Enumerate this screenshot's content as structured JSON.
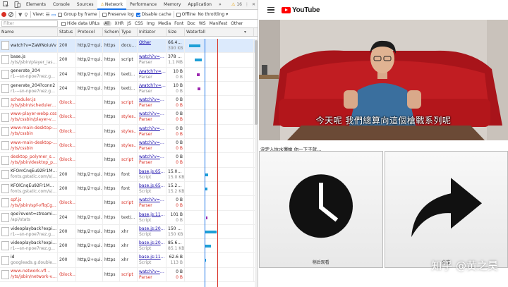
{
  "devtools": {
    "tabs": [
      "Elements",
      "Console",
      "Sources",
      "Network",
      "Performance",
      "Memory",
      "Application"
    ],
    "active_tab": "Network",
    "warning_count": "16",
    "toolbar": {
      "view_label": "View:",
      "group_by_frame": "Group by frame",
      "preserve_log": "Preserve log",
      "disable_cache": "Disable cache",
      "offline": "Offline",
      "throttling": "No throttling"
    },
    "filter": {
      "placeholder": "Filter",
      "hide_data_urls": "Hide data URLs",
      "types": [
        "All",
        "XHR",
        "JS",
        "CSS",
        "Img",
        "Media",
        "Font",
        "Doc",
        "WS",
        "Manifest",
        "Other"
      ]
    },
    "columns": [
      "Name",
      "Status",
      "Protocol",
      "Scheme",
      "Type",
      "Initiator",
      "Size",
      "Waterfall"
    ],
    "rows": [
      {
        "n1": "watch?v=ZaWNoiuVv",
        "n2": "",
        "status": "200",
        "proto": "http/2+qui...",
        "scheme": "https",
        "type": "docu...",
        "init1": "Other",
        "init2": "",
        "size1": "66.4 KB",
        "size2": "390 KB",
        "blocked": false,
        "selected": true,
        "bar_start": 0.0,
        "bar_len": 0.16,
        "bar_color": "#1e9fd6"
      },
      {
        "n1": "base.js",
        "n2": "/yts/jsbin/player_ias...",
        "status": "200",
        "proto": "http/2+qui...",
        "scheme": "https",
        "type": "script",
        "init1": "watch?v=Z...",
        "init2": "Parser",
        "size1": "378 KB",
        "size2": "1.1 MB",
        "blocked": false,
        "selected": false,
        "bar_start": 0.08,
        "bar_len": 0.1,
        "bar_color": "#1e9fd6"
      },
      {
        "n1": "generate_204",
        "n2": "r1---sn-npoe7nez.goo...",
        "status": "204",
        "proto": "http/2+qui...",
        "scheme": "https",
        "type": "text/...",
        "init1": "/watch?v=Z...",
        "init2": "Parser",
        "size1": "10 B",
        "size2": "0 B",
        "blocked": false,
        "selected": false,
        "bar_start": 0.11,
        "bar_len": 0.04,
        "bar_color": "#9c27b0"
      },
      {
        "n1": "generate_204?conn2",
        "n2": "r1---sn-npoe7nez.goo...",
        "status": "204",
        "proto": "http/2+qui...",
        "scheme": "https",
        "type": "text/...",
        "init1": "/watch?v=Z...",
        "init2": "Parser",
        "size1": "10 B",
        "size2": "0 B",
        "blocked": false,
        "selected": false,
        "bar_start": 0.12,
        "bar_len": 0.04,
        "bar_color": "#9c27b0"
      },
      {
        "n1": "scheduler.js",
        "n2": "/yts/jsbin/scheduler-...",
        "status": "(block...",
        "proto": "",
        "scheme": "https",
        "type": "script",
        "init1": "watch?v=Z...",
        "init2": "Parser",
        "size1": "0 B",
        "size2": "0 B",
        "blocked": true,
        "selected": false,
        "bar_start": 0,
        "bar_len": 0,
        "bar_color": ""
      },
      {
        "n1": "www-player-webp.css",
        "n2": "/yts/cssbin/player-vfl...",
        "status": "(block...",
        "proto": "",
        "scheme": "https",
        "type": "styles...",
        "init1": "watch?v=Z...",
        "init2": "Parser",
        "size1": "0 B",
        "size2": "0 B",
        "blocked": true,
        "selected": false,
        "bar_start": 0,
        "bar_len": 0,
        "bar_color": ""
      },
      {
        "n1": "www-main-desktop-...",
        "n2": "/yts/cssbin",
        "status": "(block...",
        "proto": "",
        "scheme": "https",
        "type": "styles...",
        "init1": "watch?v=Z...",
        "init2": "Parser",
        "size1": "0 B",
        "size2": "0 B",
        "blocked": true,
        "selected": false,
        "bar_start": 0,
        "bar_len": 0,
        "bar_color": ""
      },
      {
        "n1": "www-main-desktop-...",
        "n2": "/yts/cssbin",
        "status": "(block...",
        "proto": "",
        "scheme": "https",
        "type": "styles...",
        "init1": "watch?v=Z...",
        "init2": "Parser",
        "size1": "0 B",
        "size2": "0 B",
        "blocked": true,
        "selected": false,
        "bar_start": 0,
        "bar_len": 0,
        "bar_color": ""
      },
      {
        "n1": "desktop_polymer_sel...",
        "n2": "/yts/jsbin/desktop_po...",
        "status": "(block...",
        "proto": "",
        "scheme": "https",
        "type": "script",
        "init1": "watch?v=Z...",
        "init2": "Parser",
        "size1": "0 B",
        "size2": "0 B",
        "blocked": true,
        "selected": false,
        "bar_start": 0,
        "bar_len": 0,
        "bar_color": ""
      },
      {
        "n1": "KFOmCnqEu92Fr1Mu...",
        "n2": "fonts.gstatic.com/s/r...",
        "status": "200",
        "proto": "http/2+qui...",
        "scheme": "https",
        "type": "font",
        "init1": "base.js:6564",
        "init2": "Script",
        "size1": "15.0 KB",
        "size2": "15.0 KB",
        "blocked": false,
        "selected": false,
        "bar_start": 0.22,
        "bar_len": 0.06,
        "bar_color": "#1e9fd6"
      },
      {
        "n1": "KFOlCnqEu92Fr1Mm...",
        "n2": "fonts.gstatic.com/s/r...",
        "status": "200",
        "proto": "http/2+qui...",
        "scheme": "https",
        "type": "font",
        "init1": "base.js:6564",
        "init2": "Script",
        "size1": "15.2 KB",
        "size2": "15.2 KB",
        "blocked": false,
        "selected": false,
        "bar_start": 0.22,
        "bar_len": 0.05,
        "bar_color": "#1e9fd6"
      },
      {
        "n1": "spf.js",
        "n2": "/yts/jsbin/spf-vflqCg...",
        "status": "(block...",
        "proto": "",
        "scheme": "https",
        "type": "script",
        "init1": "watch?v=Z...",
        "init2": "Parser",
        "size1": "0 B",
        "size2": "0 B",
        "blocked": true,
        "selected": false,
        "bar_start": 0,
        "bar_len": 0,
        "bar_color": ""
      },
      {
        "n1": "qoe?event=streamin...",
        "n2": "/api/stats",
        "status": "204",
        "proto": "http/2+qui...",
        "scheme": "https",
        "type": "text/...",
        "init1": "base.js:1123",
        "init2": "Script",
        "size1": "101 B",
        "size2": "0 B",
        "blocked": false,
        "selected": false,
        "bar_start": 0.24,
        "bar_len": 0.02,
        "bar_color": "#9c27b0"
      },
      {
        "n1": "videoplayback?expir...",
        "n2": "r1---sn-npoe7nez.goo...",
        "status": "200",
        "proto": "http/2+qui...",
        "scheme": "https",
        "type": "xhr",
        "init1": "base.js:2087",
        "init2": "Script",
        "size1": "150 KB",
        "size2": "150 KB",
        "blocked": false,
        "selected": false,
        "bar_start": 0.23,
        "bar_len": 0.17,
        "bar_color": "#1e9fd6"
      },
      {
        "n1": "videoplayback?expir...",
        "n2": "r1---sn-npoe7nez.goo...",
        "status": "200",
        "proto": "http/2+qui...",
        "scheme": "https",
        "type": "xhr",
        "init1": "base.js:2087",
        "init2": "Script",
        "size1": "85.6 KB",
        "size2": "85.1 KB",
        "blocked": false,
        "selected": false,
        "bar_start": 0.23,
        "bar_len": 0.09,
        "bar_color": "#1e9fd6"
      },
      {
        "n1": "id",
        "n2": "googleads.g.doublec...",
        "status": "200",
        "proto": "http/2+qui...",
        "scheme": "https",
        "type": "xhr",
        "init1": "base.js:1105",
        "init2": "Script",
        "size1": "62.6 B",
        "size2": "113 B",
        "blocked": false,
        "selected": false,
        "bar_start": 0.22,
        "bar_len": 0.03,
        "bar_color": "#1e9fd6"
      },
      {
        "n1": "www-network-vfl...",
        "n2": "/yts/jsbin/network-vfl...",
        "status": "(block...",
        "proto": "",
        "scheme": "https",
        "type": "script",
        "init1": "watch?v=Z...",
        "init2": "Parser",
        "size1": "0 B",
        "size2": "0 B",
        "blocked": true,
        "selected": false,
        "bar_start": 0,
        "bar_len": 0,
        "bar_color": ""
      }
    ]
  },
  "youtube": {
    "logo_text": "YouTube",
    "caption": "今天呢 我們總算向這個槍戰系列呢",
    "question": "決定入坑水彈槍 你一下子就...",
    "choice_left_label": "稍后观看",
    "choice_right_label": "分享",
    "watermark": "知乎 @黄之昊",
    "colors": {
      "sofa": "#b3161b",
      "shirt": "#3a6f9e",
      "wall": "#d8d2cc"
    }
  }
}
